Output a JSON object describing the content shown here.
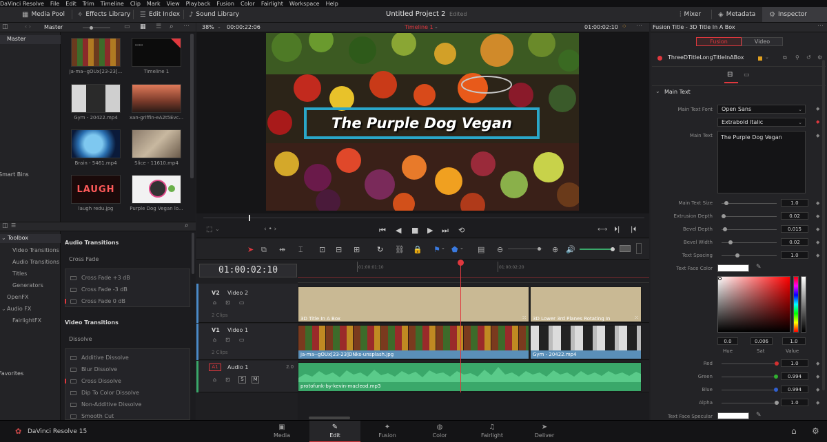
{
  "menu": [
    "DaVinci Resolve",
    "File",
    "Edit",
    "Trim",
    "Timeline",
    "Clip",
    "Mark",
    "View",
    "Playback",
    "Fusion",
    "Color",
    "Fairlight",
    "Workspace",
    "Help"
  ],
  "toolbar": {
    "media_pool": "Media Pool",
    "effects_library": "Effects Library",
    "edit_index": "Edit Index",
    "sound_library": "Sound Library",
    "project_title": "Untitled Project 2",
    "project_status": "Edited",
    "mixer": "Mixer",
    "metadata": "Metadata",
    "inspector": "Inspector"
  },
  "media_pool": {
    "bin_name": "Master",
    "bins": {
      "master": "Master",
      "smart_bins": "Smart Bins",
      "favorites": "Favorites"
    },
    "clips": [
      {
        "name": "ja-ma--gOUx[23-23]..."
      },
      {
        "name": "Timeline 1"
      },
      {
        "name": "Gym - 20422.mp4"
      },
      {
        "name": "xan-griffin-eA2t5Evc..."
      },
      {
        "name": "Brain - 5461.mp4"
      },
      {
        "name": "Slice - 11610.mp4"
      },
      {
        "name": "laugh redu.jpg"
      },
      {
        "name": "Purple Dog Vegan lo..."
      }
    ],
    "laugh_text": "LAUGH"
  },
  "effects": {
    "toolbox": "Toolbox",
    "tree": [
      "Video Transitions",
      "Audio Transitions",
      "Titles",
      "Generators",
      "OpenFX",
      "Audio FX",
      "FairlightFX"
    ],
    "audio_transitions_title": "Audio Transitions",
    "cross_fade_title": "Cross Fade",
    "audio_items": [
      "Cross Fade +3 dB",
      "Cross Fade -3 dB",
      "Cross Fade 0 dB"
    ],
    "video_transitions_title": "Video Transitions",
    "dissolve_title": "Dissolve",
    "video_items": [
      "Additive Dissolve",
      "Blur Dissolve",
      "Cross Dissolve",
      "Dip To Color Dissolve",
      "Non-Additive Dissolve",
      "Smooth Cut"
    ]
  },
  "viewer": {
    "zoom": "38%",
    "source_tc": "00:00:22:06",
    "timeline_name": "Timeline 1",
    "record_tc": "01:00:02:10",
    "title_text": "The Purple Dog Vegan"
  },
  "timeline": {
    "timecode": "01:00:02:10",
    "ruler_marks": [
      "01:00:01:10",
      "01:00:02:20"
    ],
    "tracks": {
      "v2": {
        "id": "V2",
        "name": "Video 2",
        "clips_count": "2 Clips"
      },
      "v1": {
        "id": "V1",
        "name": "Video 1",
        "clips_count": "2 Clips"
      },
      "a1": {
        "id": "A1",
        "name": "Audio 1",
        "level": "2.0"
      }
    },
    "clips": {
      "v2_a": "3D Title In A Box",
      "v2_b": "3D Lower 3rd Planes Rotating In",
      "v1_a": "ja-ma--gOUx[23-23]DNks-unsplash.jpg",
      "v1_b": "Gym - 20422.mp4",
      "a1": "protofunk-by-kevin-macleod.mp3"
    },
    "mute_label": "S",
    "solo_label": "M"
  },
  "inspector": {
    "header": "Fusion Title - 3D Title In A Box",
    "tabs": [
      "Fusion",
      "Video"
    ],
    "node_name": "ThreeDTitleLongTitleInABox",
    "section": "Main Text",
    "font_label": "Main Text Font",
    "font": "Open Sans",
    "style": "Extrabold Italic",
    "text_label": "Main Text",
    "text": "The Purple Dog Vegan",
    "params": [
      {
        "label": "Main Text Size",
        "value": "1.0"
      },
      {
        "label": "Extrusion Depth",
        "value": "0.02"
      },
      {
        "label": "Bevel Depth",
        "value": "0.015"
      },
      {
        "label": "Bevel Width",
        "value": "0.02"
      },
      {
        "label": "Text Spacing",
        "value": "1.0"
      }
    ],
    "face_color_label": "Text Face Color",
    "hsv": {
      "hue": "0.0",
      "sat": "0.006",
      "value": "1.0",
      "hue_label": "Hue",
      "sat_label": "Sat",
      "value_label": "Value"
    },
    "rgba": [
      {
        "label": "Red",
        "value": "1.0",
        "color": "#d23030"
      },
      {
        "label": "Green",
        "value": "0.994",
        "color": "#30b030"
      },
      {
        "label": "Blue",
        "value": "0.994",
        "color": "#3060d0"
      },
      {
        "label": "Alpha",
        "value": "1.0",
        "color": "#aaaaaa"
      }
    ],
    "specular_label": "Text Face Specular"
  },
  "pages": [
    {
      "label": "Media",
      "icon": "▣"
    },
    {
      "label": "Edit",
      "icon": "✎"
    },
    {
      "label": "Fusion",
      "icon": "✦"
    },
    {
      "label": "Color",
      "icon": "◍"
    },
    {
      "label": "Fairlight",
      "icon": "♫"
    },
    {
      "label": "Deliver",
      "icon": "➤"
    }
  ],
  "app_name": "DaVinci Resolve 15",
  "colors": {
    "accent": "#e0383e",
    "title_box": "#2aa7c9",
    "audio": "#3aa86a",
    "v2": "#c9b994",
    "v1_label": "#5a8fb8"
  }
}
